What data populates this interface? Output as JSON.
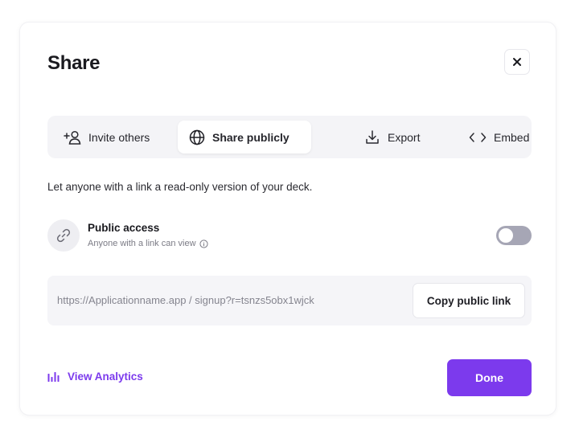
{
  "dialog": {
    "title": "Share",
    "close_icon": "close-icon"
  },
  "tabs": [
    {
      "label": "Invite others",
      "icon": "add-user-icon",
      "active": false
    },
    {
      "label": "Share publicly",
      "icon": "globe-icon",
      "active": true
    },
    {
      "label": "Export",
      "icon": "download-icon",
      "active": false
    },
    {
      "label": "Embed",
      "icon": "code-icon",
      "active": false
    }
  ],
  "description": "Let anyone with a link a read-only version of your deck.",
  "public_access": {
    "title": "Public access",
    "subtitle": "Anyone with a link can view",
    "icon": "link-icon",
    "info_icon": "info-icon",
    "enabled": false
  },
  "link": {
    "url": "https://Applicationname.app / signup?r=tsnzs5obx1wjck",
    "copy_label": "Copy public link"
  },
  "footer": {
    "analytics_label": "View Analytics",
    "analytics_icon": "bar-chart-icon",
    "done_label": "Done"
  },
  "colors": {
    "accent": "#7c3aed",
    "toggle_off": "#a6a6b5"
  }
}
